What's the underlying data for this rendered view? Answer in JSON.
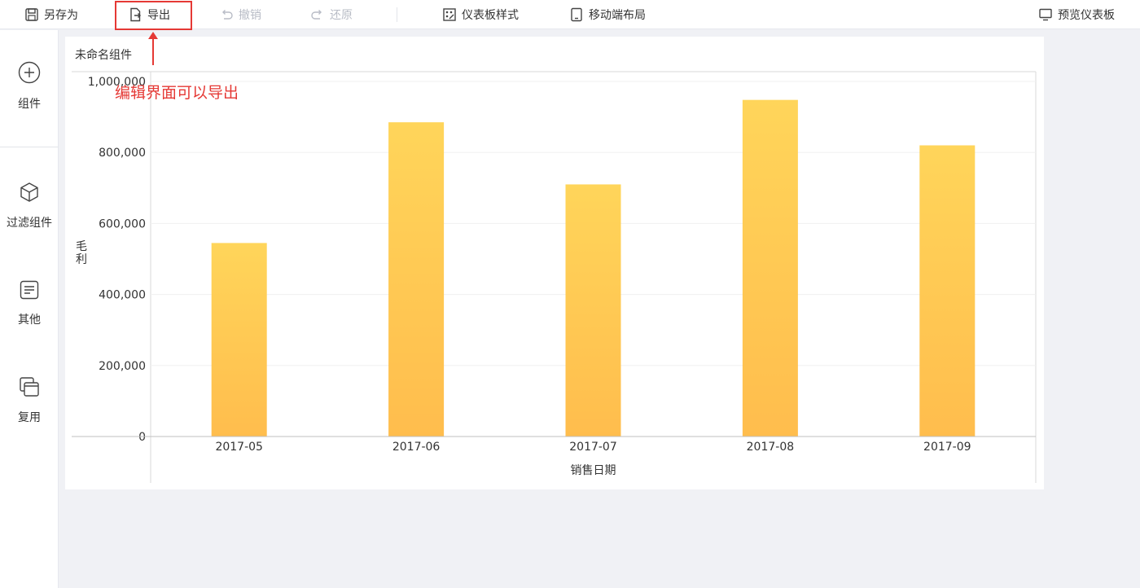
{
  "toolbar": {
    "save_as": "另存为",
    "export": "导出",
    "undo": "撤销",
    "redo": "还原",
    "dashboard_style": "仪表板样式",
    "mobile_layout": "移动端布局",
    "preview": "预览仪表板"
  },
  "sidebar": {
    "items": [
      {
        "label": "组件",
        "icon": "plus-circle-icon"
      },
      {
        "label": "过滤组件",
        "icon": "cube-icon"
      },
      {
        "label": "其他",
        "icon": "document-icon"
      },
      {
        "label": "复用",
        "icon": "copy-icon"
      }
    ]
  },
  "widget": {
    "title": "未命名组件"
  },
  "annotation": {
    "text": "编辑界面可以导出",
    "color": "#e53935"
  },
  "chart_data": {
    "type": "bar",
    "title": "",
    "xlabel": "销售日期",
    "ylabel": "毛利",
    "categories": [
      "2017-05",
      "2017-06",
      "2017-07",
      "2017-08",
      "2017-09"
    ],
    "values": [
      545000,
      885000,
      710000,
      948000,
      820000
    ],
    "ylim": [
      0,
      1000000
    ],
    "yticks": [
      0,
      200000,
      400000,
      600000,
      800000,
      1000000
    ],
    "ytick_labels": [
      "0",
      "200,000",
      "400,000",
      "600,000",
      "800,000",
      "1,000,000"
    ],
    "grid": true,
    "bar_color_top": "#ffd55a",
    "bar_color_bottom": "#ffbd4d"
  }
}
